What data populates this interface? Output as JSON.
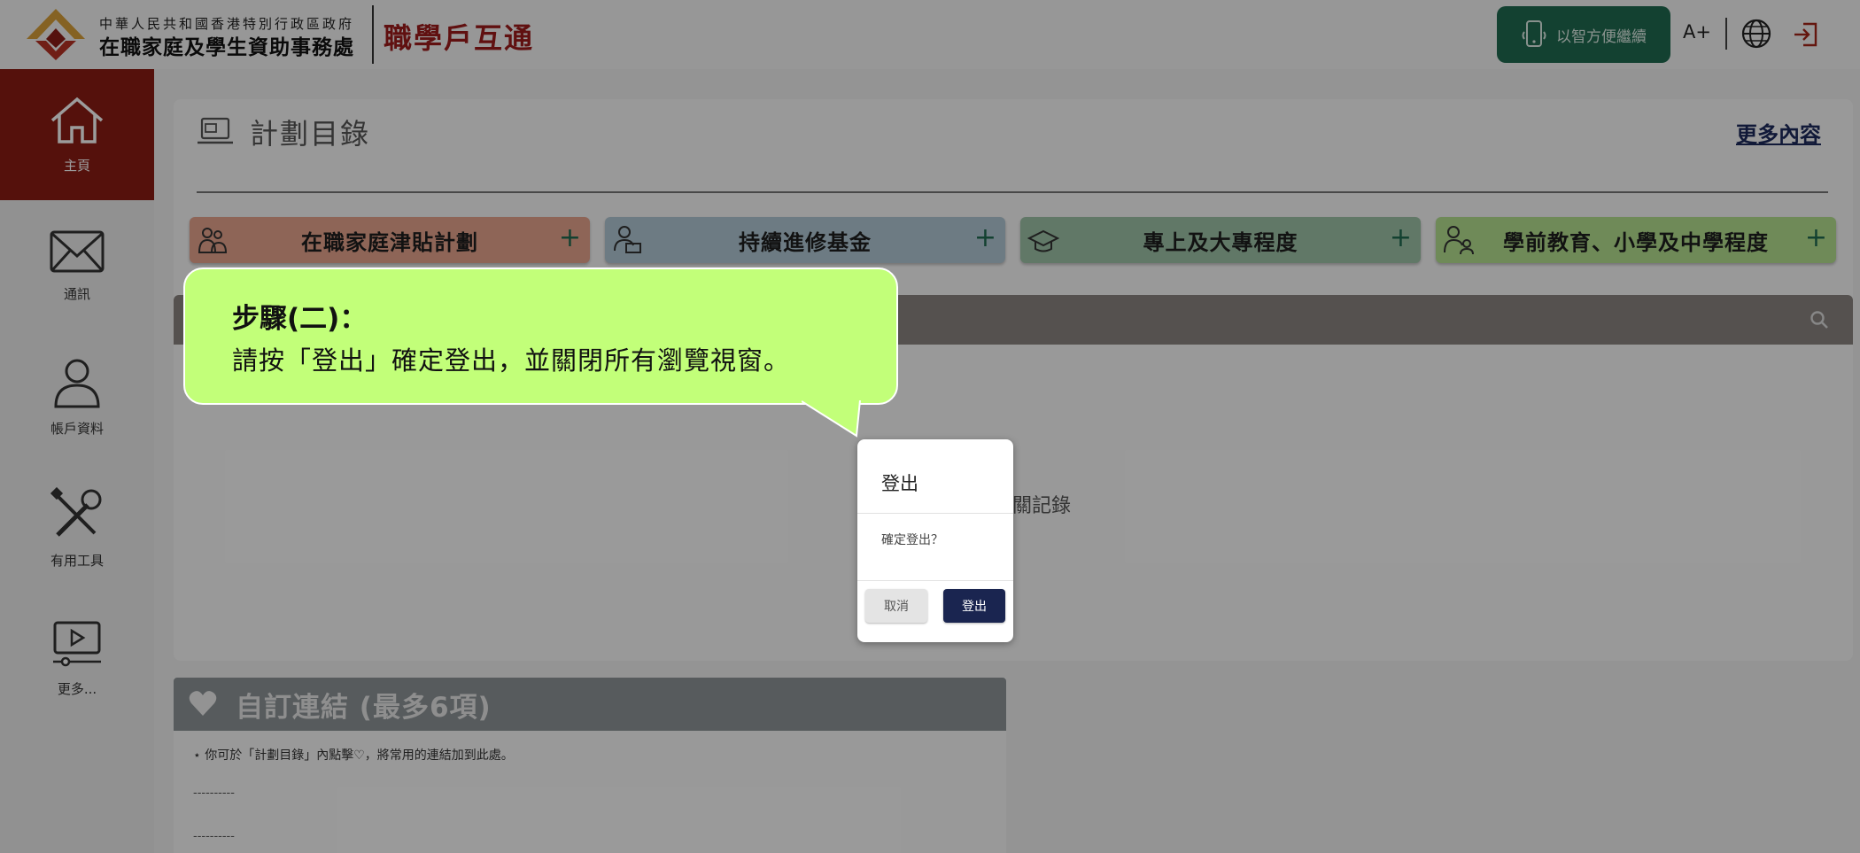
{
  "header": {
    "gov_name": "中華人民共和國香港特別行政區政府",
    "office_name": "在職家庭及學生資助事務處",
    "portal_name": "職學戶互通",
    "mobile_button": "以智方便繼續",
    "font_size_button": "A+",
    "icons": [
      "logo-icon",
      "phone-icon",
      "globe-icon",
      "logout-icon"
    ]
  },
  "sidebar": {
    "items": [
      {
        "label": "主頁",
        "icon": "home-icon",
        "active": true
      },
      {
        "label": "通訊",
        "icon": "mail-icon"
      },
      {
        "label": "帳戶資料",
        "icon": "user-icon"
      },
      {
        "label": "有用工具",
        "icon": "tools-icon"
      },
      {
        "label": "更多...",
        "icon": "video-icon"
      }
    ]
  },
  "catalog": {
    "title": "計劃目錄",
    "more_link": "更多內容",
    "tabs": [
      {
        "label": "在職家庭津貼計劃",
        "color": "#e9a58f",
        "icon": "family-icon"
      },
      {
        "label": "持續進修基金",
        "color": "#b2cad6",
        "icon": "laptop-user-icon"
      },
      {
        "label": "專上及大專程度",
        "color": "#9fc5a9",
        "icon": "graduation-cap-icon"
      },
      {
        "label": "學前教育、小學及中學程度",
        "color": "#b5e291",
        "icon": "parent-child-icon"
      }
    ],
    "no_record_text": "關記錄"
  },
  "custom_links": {
    "title": "自訂連結 (最多6項)",
    "note": "⋆ 你可於「計劃目錄」內點擊♡，將常用的連結加到此處。",
    "placeholder_1": "----------",
    "placeholder_2": "----------"
  },
  "tooltip": {
    "step_title": "步驟(二)：",
    "instruction": "請按「登出」確定登出，並關閉所有瀏覽視窗。"
  },
  "dialog": {
    "title": "登出",
    "message": "確定登出？",
    "cancel_label": "取消",
    "confirm_label": "登出"
  },
  "colors": {
    "brand_red": "#8b1c14",
    "accent_green": "#1f6b50",
    "dialog_confirm": "#1a2550",
    "bubble_green": "#c2ff79"
  }
}
